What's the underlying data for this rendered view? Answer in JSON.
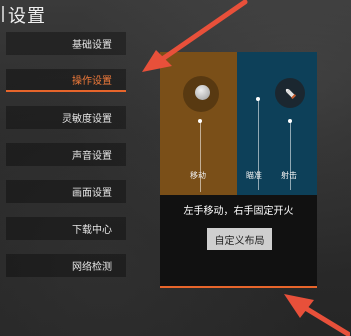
{
  "header": {
    "title": "设置"
  },
  "sidebar": {
    "items": [
      {
        "label": "基础设置"
      },
      {
        "label": "操作设置"
      },
      {
        "label": "灵敏度设置"
      },
      {
        "label": "声音设置"
      },
      {
        "label": "画面设置"
      },
      {
        "label": "下载中心"
      },
      {
        "label": "网络检测"
      }
    ],
    "active_index": 1
  },
  "preview": {
    "move_label": "移动",
    "aim_label": "瞄准",
    "fire_label": "射击",
    "description": "左手移动，右手固定开火",
    "custom_button": "自定义布局"
  },
  "icons": [
    "joystick-icon",
    "bullet-icon",
    "arrow-annotation"
  ],
  "colors": {
    "accent": "#e7652b",
    "left_zone": "#7a4f18",
    "right_zone": "#0d4059",
    "annotation_arrow": "#e8503a"
  }
}
